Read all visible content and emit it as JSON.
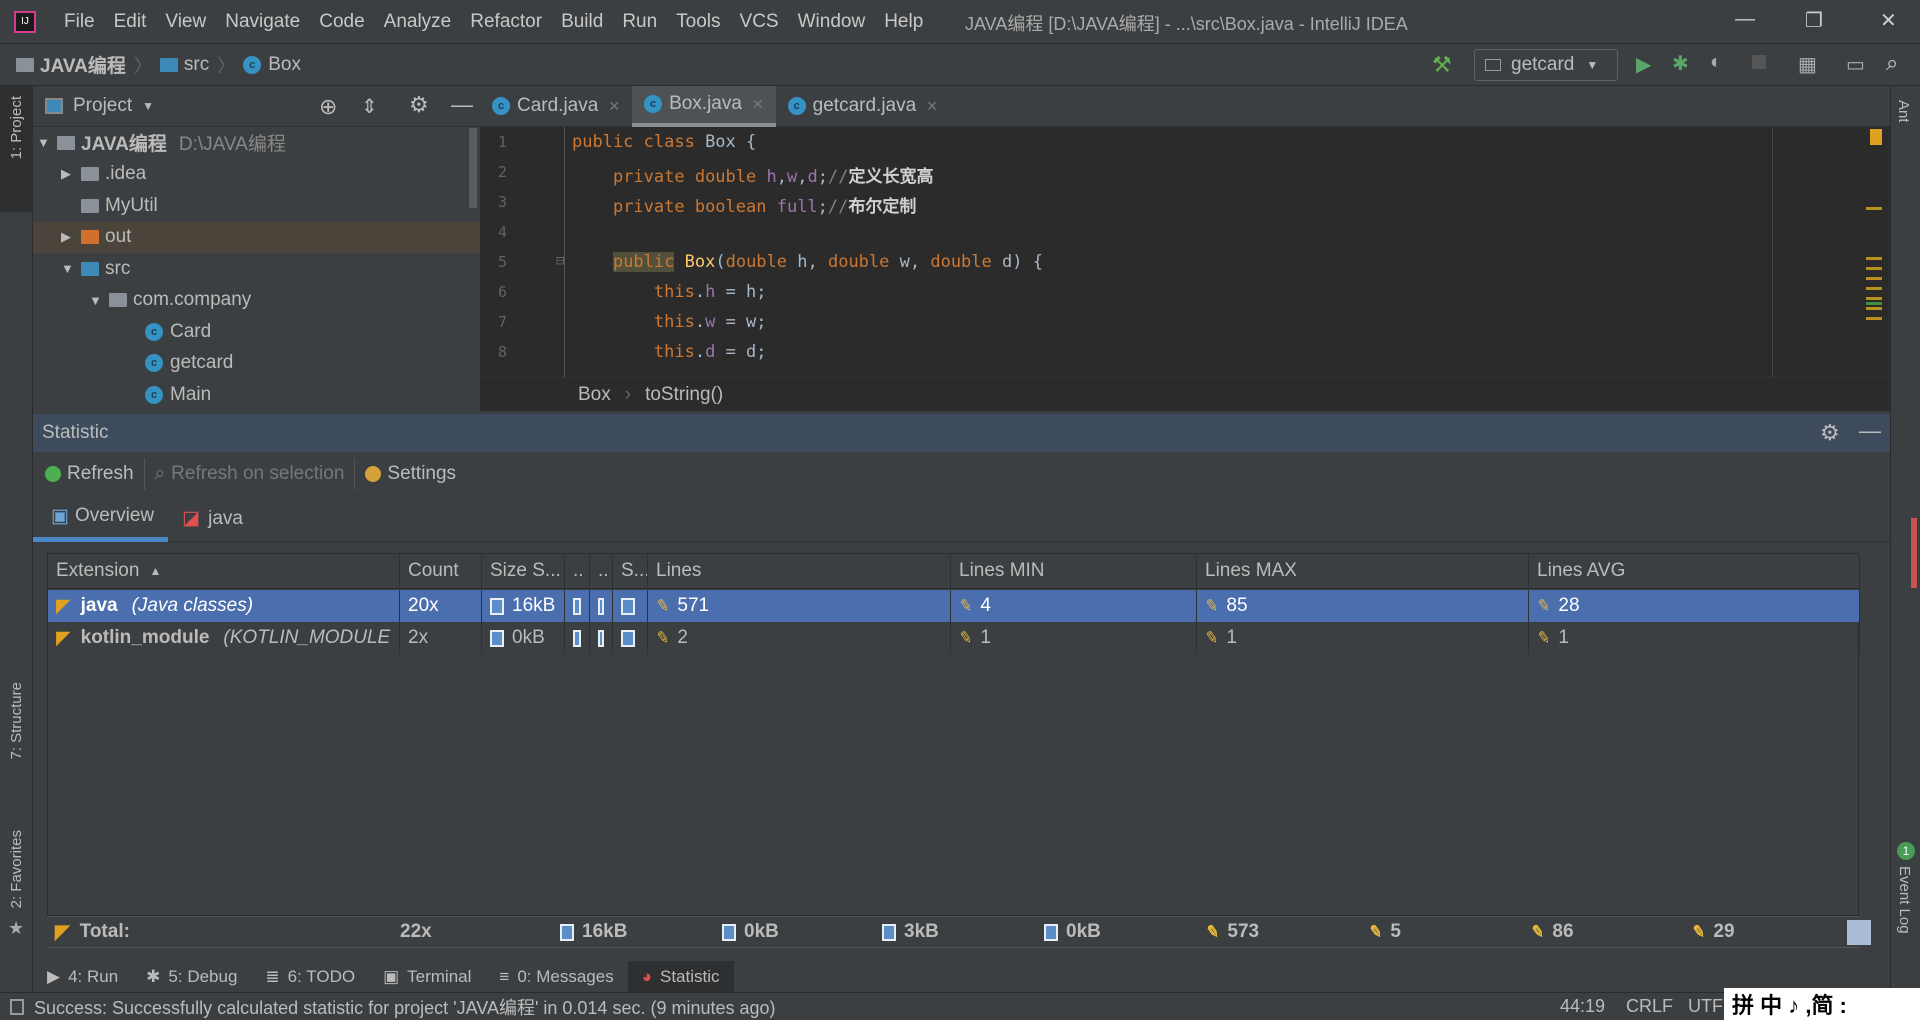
{
  "menu": [
    "File",
    "Edit",
    "View",
    "Navigate",
    "Code",
    "Analyze",
    "Refactor",
    "Build",
    "Run",
    "Tools",
    "VCS",
    "Window",
    "Help"
  ],
  "window_title": "JAVA编程 [D:\\JAVA编程] - ...\\src\\Box.java - IntelliJ IDEA",
  "nav": {
    "project": "JAVA编程",
    "src": "src",
    "file": "Box",
    "run_config": "getcard"
  },
  "left_stripe": {
    "project": "1: Project",
    "structure": "7: Structure",
    "favorites": "2: Favorites"
  },
  "right_stripe": {
    "ant": "Ant",
    "event_log": "Event Log",
    "event_count": "1"
  },
  "project_panel": {
    "title": "Project",
    "tree": [
      {
        "label": "JAVA编程",
        "hint": "D:\\JAVA编程"
      },
      {
        "label": ".idea"
      },
      {
        "label": "MyUtil"
      },
      {
        "label": "out"
      },
      {
        "label": "src"
      },
      {
        "label": "com.company"
      },
      {
        "label": "Card"
      },
      {
        "label": "getcard"
      },
      {
        "label": "Main"
      }
    ]
  },
  "editor": {
    "tabs": [
      {
        "label": "Card.java"
      },
      {
        "label": "Box.java"
      },
      {
        "label": "getcard.java"
      }
    ],
    "active_tab": "Box.java",
    "line_numbers": [
      "1",
      "2",
      "3",
      "4",
      "5",
      "6",
      "7",
      "8"
    ],
    "breadcrumb": [
      "Box",
      "toString()"
    ]
  },
  "statistic": {
    "title": "Statistic",
    "toolbar": {
      "refresh": "Refresh",
      "refresh_sel": "Refresh on selection",
      "settings": "Settings"
    },
    "tabs": [
      "Overview",
      "java"
    ],
    "columns": [
      "Extension",
      "Count",
      "Size S...",
      "..",
      "..",
      "S...",
      "Lines",
      "Lines MIN",
      "Lines MAX",
      "Lines AVG"
    ],
    "sort_column": "Extension",
    "rows": [
      {
        "ext": "java",
        "desc": "(Java classes)",
        "count": "20x",
        "size": "16kB",
        "lines": "571",
        "min": "4",
        "max": "85",
        "avg": "28",
        "selected": true
      },
      {
        "ext": "kotlin_module",
        "desc": "(KOTLIN_MODULE",
        "count": "2x",
        "size": "0kB",
        "lines": "2",
        "min": "1",
        "max": "1",
        "avg": "1",
        "selected": false
      }
    ],
    "total": {
      "label": "Total:",
      "count": "22x",
      "s1": "16kB",
      "s2": "0kB",
      "s3": "3kB",
      "s4": "0kB",
      "lines": "573",
      "min": "5",
      "max": "86",
      "avg": "29"
    }
  },
  "bottom_tools": [
    "4: Run",
    "5: Debug",
    "6: TODO",
    "Terminal",
    "0: Messages",
    "Statistic"
  ],
  "status": {
    "message": "Success: Successfully calculated statistic for project 'JAVA编程' in 0.014 sec. (9 minutes ago)",
    "position": "44:19",
    "line_sep": "CRLF",
    "encoding": "UTF"
  },
  "ime": "拼 中 ♪ ,简 :"
}
